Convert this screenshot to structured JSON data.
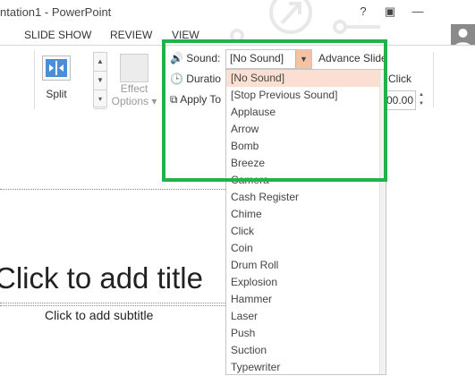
{
  "window": {
    "title": "ntation1 - PowerPoint",
    "help_glyph": "?",
    "restore_glyph": "▣",
    "minimize_glyph": "—"
  },
  "ribbon_tabs": [
    "SLIDE SHOW",
    "REVIEW",
    "VIEW"
  ],
  "transitions": {
    "split_label": "Split",
    "effect_options_line1": "Effect",
    "effect_options_line2": "Options"
  },
  "timing": {
    "sound_label": "Sound:",
    "sound_value": "[No Sound]",
    "duration_label": "Duratio",
    "apply_label": "Apply To",
    "advance_label": "Advance Slide",
    "on_click_label": "e Click",
    "after_value": "00.00"
  },
  "slide": {
    "title": "Click to add title",
    "subtitle": "Click to add subtitle"
  },
  "sound_options": [
    "[No Sound]",
    "[Stop Previous Sound]",
    "Applause",
    "Arrow",
    "Bomb",
    "Breeze",
    "Camera",
    "Cash Register",
    "Chime",
    "Click",
    "Coin",
    "Drum Roll",
    "Explosion",
    "Hammer",
    "Laser",
    "Push",
    "Suction",
    "Typewriter"
  ],
  "colors": {
    "highlight": "#22b14c",
    "selected_item": "#fcdfd3",
    "dropdown_arrow": "#f4c3a6"
  }
}
